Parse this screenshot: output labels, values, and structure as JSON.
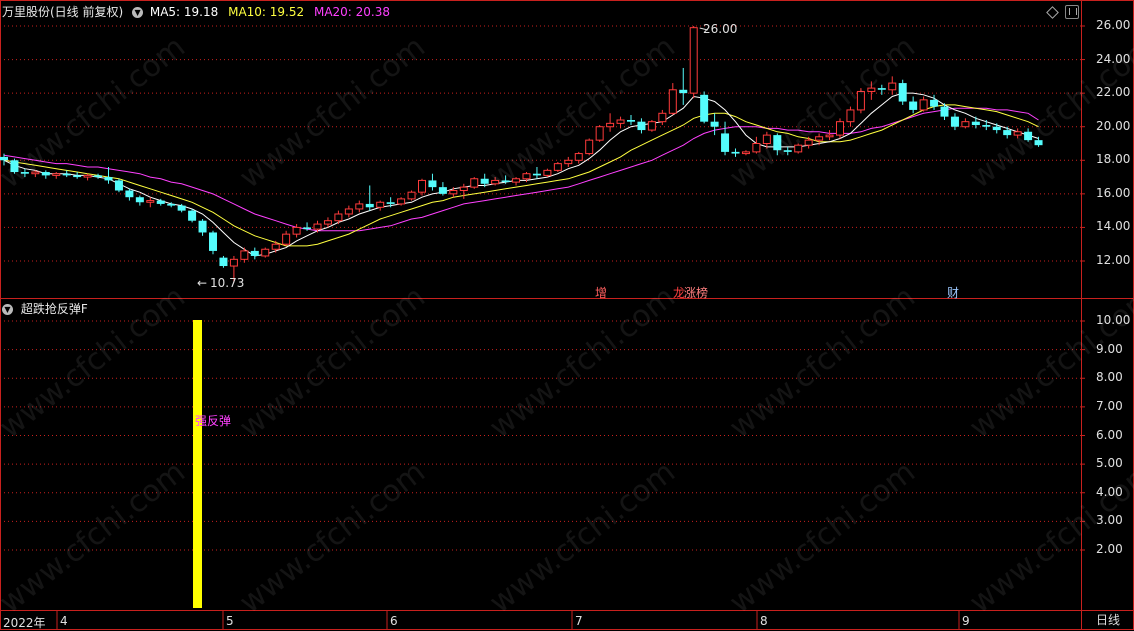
{
  "main_panel": {
    "title": "万里股份(日线 前复权)",
    "ma5": "MA5: 19.18",
    "ma10": "MA10: 19.52",
    "ma20": "MA20: 20.38",
    "colors": {
      "ma5": "#ffffff",
      "ma10": "#ffff40",
      "ma20": "#ff40ff",
      "up": "#ff3b3b",
      "down": "#54fcfc"
    },
    "y_ticks": [
      "26.00",
      "24.00",
      "22.00",
      "20.00",
      "18.00",
      "16.00",
      "14.00",
      "12.00"
    ],
    "high_label": "26.00",
    "low_label": "10.73",
    "events": {
      "increase": "增",
      "dragon_tiger": "龙",
      "limit_rank": "涨榜",
      "finance": "财"
    }
  },
  "sub_panel": {
    "title": "超跌抢反弹F",
    "signal_label": "强反弹",
    "signal_color": "#ffff00",
    "y_ticks": [
      "10.00",
      "9.00",
      "8.00",
      "7.00",
      "6.00",
      "5.00",
      "4.00",
      "3.00",
      "2.00"
    ]
  },
  "x_axis": {
    "year": "2022年",
    "months": [
      "4",
      "5",
      "6",
      "7",
      "8",
      "9"
    ]
  },
  "period_label": "日线",
  "watermark": "www.cfchi.com",
  "chart_data": {
    "type": "candlestick",
    "title": "万里股份(日线 前复权)",
    "ylim": [
      11.0,
      26.7
    ],
    "months": [
      "4",
      "5",
      "6",
      "7",
      "8",
      "9"
    ],
    "ohlc": [
      [
        18.2,
        18.4,
        17.7,
        18.0
      ],
      [
        18.0,
        18.1,
        17.2,
        17.3
      ],
      [
        17.3,
        17.5,
        17.0,
        17.2
      ],
      [
        17.2,
        17.4,
        17.0,
        17.3
      ],
      [
        17.3,
        17.4,
        16.9,
        17.1
      ],
      [
        17.1,
        17.3,
        16.9,
        17.2
      ],
      [
        17.2,
        17.4,
        17.0,
        17.1
      ],
      [
        17.1,
        17.3,
        16.9,
        17.0
      ],
      [
        17.0,
        17.2,
        16.8,
        17.1
      ],
      [
        17.1,
        17.2,
        16.9,
        17.0
      ],
      [
        17.0,
        17.6,
        16.6,
        16.8
      ],
      [
        16.8,
        16.9,
        16.1,
        16.2
      ],
      [
        16.2,
        16.3,
        15.6,
        15.8
      ],
      [
        15.8,
        15.9,
        15.3,
        15.5
      ],
      [
        15.5,
        15.8,
        15.2,
        15.6
      ],
      [
        15.6,
        15.7,
        15.3,
        15.4
      ],
      [
        15.4,
        15.5,
        15.2,
        15.3
      ],
      [
        15.3,
        15.4,
        14.9,
        15.0
      ],
      [
        15.0,
        15.1,
        14.3,
        14.4
      ],
      [
        14.4,
        14.5,
        13.5,
        13.7
      ],
      [
        13.7,
        13.8,
        12.4,
        12.6
      ],
      [
        12.2,
        12.3,
        11.6,
        11.7
      ],
      [
        11.7,
        12.3,
        10.73,
        12.1
      ],
      [
        12.1,
        12.8,
        11.9,
        12.6
      ],
      [
        12.6,
        12.8,
        12.1,
        12.3
      ],
      [
        12.3,
        12.8,
        12.2,
        12.7
      ],
      [
        12.7,
        13.2,
        12.5,
        13.0
      ],
      [
        13.0,
        13.8,
        12.9,
        13.6
      ],
      [
        13.6,
        14.2,
        13.4,
        14.0
      ],
      [
        14.0,
        14.3,
        13.8,
        13.9
      ],
      [
        13.9,
        14.4,
        13.7,
        14.2
      ],
      [
        14.2,
        14.6,
        14.0,
        14.4
      ],
      [
        14.4,
        15.0,
        14.2,
        14.8
      ],
      [
        14.8,
        15.3,
        14.6,
        15.1
      ],
      [
        15.1,
        15.6,
        14.9,
        15.4
      ],
      [
        15.4,
        16.5,
        15.0,
        15.2
      ],
      [
        15.2,
        15.6,
        15.0,
        15.5
      ],
      [
        15.5,
        15.8,
        15.2,
        15.4
      ],
      [
        15.4,
        15.8,
        15.3,
        15.7
      ],
      [
        15.7,
        16.2,
        15.6,
        16.1
      ],
      [
        16.1,
        16.9,
        15.9,
        16.8
      ],
      [
        16.8,
        17.2,
        16.2,
        16.4
      ],
      [
        16.4,
        16.7,
        15.9,
        16.0
      ],
      [
        16.0,
        16.4,
        15.8,
        16.2
      ],
      [
        16.2,
        16.6,
        15.7,
        16.4
      ],
      [
        16.4,
        17.0,
        16.3,
        16.9
      ],
      [
        16.9,
        17.2,
        16.4,
        16.6
      ],
      [
        16.6,
        17.0,
        16.5,
        16.8
      ],
      [
        16.8,
        17.1,
        16.6,
        16.7
      ],
      [
        16.7,
        17.0,
        16.5,
        16.9
      ],
      [
        16.9,
        17.3,
        16.7,
        17.2
      ],
      [
        17.2,
        17.6,
        16.9,
        17.1
      ],
      [
        17.1,
        17.5,
        17.0,
        17.4
      ],
      [
        17.4,
        17.9,
        17.3,
        17.8
      ],
      [
        17.8,
        18.2,
        17.6,
        18.0
      ],
      [
        18.0,
        18.5,
        17.8,
        18.4
      ],
      [
        18.4,
        19.3,
        18.3,
        19.2
      ],
      [
        19.2,
        20.1,
        19.1,
        20.0
      ],
      [
        20.0,
        20.8,
        19.7,
        20.2
      ],
      [
        20.2,
        20.6,
        19.9,
        20.4
      ],
      [
        20.4,
        20.7,
        20.1,
        20.3
      ],
      [
        20.3,
        20.5,
        19.6,
        19.8
      ],
      [
        19.8,
        20.4,
        19.7,
        20.3
      ],
      [
        20.3,
        21.0,
        20.1,
        20.8
      ],
      [
        20.8,
        22.6,
        20.7,
        22.2
      ],
      [
        22.2,
        23.5,
        21.3,
        22.0
      ],
      [
        22.0,
        26.0,
        21.7,
        25.9
      ],
      [
        21.9,
        22.1,
        20.2,
        20.3
      ],
      [
        20.3,
        20.8,
        19.5,
        20.0
      ],
      [
        19.6,
        20.3,
        18.3,
        18.5
      ],
      [
        18.5,
        18.7,
        18.2,
        18.4
      ],
      [
        18.4,
        18.6,
        18.3,
        18.5
      ],
      [
        18.5,
        19.4,
        18.4,
        19.0
      ],
      [
        19.0,
        19.7,
        18.7,
        19.5
      ],
      [
        19.5,
        19.6,
        18.3,
        18.6
      ],
      [
        18.6,
        18.8,
        18.3,
        18.5
      ],
      [
        18.5,
        19.0,
        18.4,
        18.9
      ],
      [
        18.9,
        19.4,
        18.7,
        19.2
      ],
      [
        19.2,
        19.6,
        18.9,
        19.4
      ],
      [
        19.4,
        19.8,
        19.2,
        19.5
      ],
      [
        19.5,
        20.5,
        19.3,
        20.3
      ],
      [
        20.3,
        21.2,
        20.0,
        21.0
      ],
      [
        21.0,
        22.3,
        20.8,
        22.1
      ],
      [
        22.1,
        22.7,
        21.6,
        22.3
      ],
      [
        22.3,
        22.5,
        21.9,
        22.2
      ],
      [
        22.2,
        23.0,
        21.9,
        22.6
      ],
      [
        22.6,
        22.8,
        21.3,
        21.5
      ],
      [
        21.5,
        21.8,
        20.8,
        21.0
      ],
      [
        21.0,
        21.8,
        20.9,
        21.6
      ],
      [
        21.6,
        21.9,
        21.0,
        21.2
      ],
      [
        21.2,
        21.4,
        20.4,
        20.6
      ],
      [
        20.6,
        20.8,
        19.8,
        20.0
      ],
      [
        20.0,
        20.5,
        19.9,
        20.3
      ],
      [
        20.3,
        20.6,
        19.9,
        20.1
      ],
      [
        20.1,
        20.4,
        19.8,
        20.0
      ],
      [
        20.0,
        20.2,
        19.6,
        19.8
      ],
      [
        19.8,
        20.0,
        19.3,
        19.5
      ],
      [
        19.5,
        19.9,
        19.3,
        19.7
      ],
      [
        19.7,
        19.9,
        19.1,
        19.2
      ],
      [
        19.2,
        19.4,
        18.8,
        18.9
      ]
    ],
    "ma5": [
      18.0,
      17.7,
      17.5,
      17.4,
      17.2,
      17.2,
      17.2,
      17.1,
      17.1,
      17.0,
      16.9,
      16.6,
      16.3,
      16.1,
      15.8,
      15.6,
      15.4,
      15.3,
      15.1,
      14.8,
      14.3,
      13.7,
      13.1,
      12.7,
      12.3,
      12.4,
      12.6,
      12.8,
      13.2,
      13.5,
      13.8,
      14.0,
      14.3,
      14.5,
      14.8,
      15.0,
      15.2,
      15.3,
      15.4,
      15.5,
      15.8,
      16.0,
      16.1,
      16.3,
      16.4,
      16.5,
      16.5,
      16.6,
      16.7,
      16.8,
      16.8,
      16.9,
      17.0,
      17.2,
      17.5,
      17.7,
      18.1,
      18.6,
      19.2,
      19.7,
      20.0,
      20.1,
      20.2,
      20.3,
      20.7,
      21.1,
      21.8,
      21.7,
      21.5,
      21.0,
      20.3,
      19.5,
      19.0,
      18.8,
      18.8,
      18.8,
      18.8,
      18.9,
      19.0,
      19.1,
      19.3,
      19.6,
      20.2,
      20.8,
      21.3,
      21.8,
      22.0,
      22.0,
      21.9,
      21.7,
      21.3,
      21.0,
      20.8,
      20.5,
      20.3,
      20.1,
      19.9,
      19.7,
      19.5,
      19.3
    ],
    "ma10": [
      18.0,
      17.9,
      17.8,
      17.7,
      17.6,
      17.5,
      17.4,
      17.3,
      17.2,
      17.1,
      17.0,
      16.9,
      16.7,
      16.5,
      16.3,
      16.1,
      15.9,
      15.7,
      15.5,
      15.2,
      14.9,
      14.5,
      14.1,
      13.8,
      13.5,
      13.3,
      13.1,
      12.9,
      12.9,
      12.9,
      13.0,
      13.2,
      13.4,
      13.6,
      13.9,
      14.2,
      14.5,
      14.7,
      14.9,
      15.1,
      15.3,
      15.5,
      15.6,
      15.8,
      15.9,
      16.0,
      16.1,
      16.2,
      16.3,
      16.4,
      16.5,
      16.6,
      16.7,
      16.8,
      16.9,
      17.1,
      17.3,
      17.6,
      17.9,
      18.2,
      18.6,
      18.9,
      19.2,
      19.5,
      19.8,
      20.1,
      20.5,
      20.7,
      20.8,
      20.8,
      20.6,
      20.3,
      20.1,
      19.9,
      19.7,
      19.6,
      19.4,
      19.3,
      19.1,
      19.1,
      19.1,
      19.2,
      19.4,
      19.6,
      19.8,
      20.1,
      20.4,
      20.7,
      21.0,
      21.2,
      21.3,
      21.3,
      21.2,
      21.1,
      21.0,
      20.9,
      20.7,
      20.5,
      20.3,
      20.0
    ],
    "ma20": [
      18.3,
      18.2,
      18.1,
      18.0,
      17.9,
      17.8,
      17.8,
      17.7,
      17.6,
      17.6,
      17.5,
      17.4,
      17.3,
      17.2,
      17.0,
      16.9,
      16.7,
      16.6,
      16.4,
      16.2,
      16.0,
      15.7,
      15.4,
      15.1,
      14.8,
      14.6,
      14.4,
      14.2,
      14.0,
      13.9,
      13.8,
      13.8,
      13.8,
      13.8,
      13.8,
      13.9,
      14.0,
      14.1,
      14.3,
      14.5,
      14.6,
      14.8,
      15.0,
      15.2,
      15.4,
      15.5,
      15.6,
      15.7,
      15.8,
      15.9,
      16.0,
      16.1,
      16.2,
      16.3,
      16.4,
      16.6,
      16.8,
      17.0,
      17.2,
      17.4,
      17.6,
      17.8,
      18.0,
      18.3,
      18.6,
      18.9,
      19.3,
      19.6,
      19.8,
      19.9,
      20.0,
      20.0,
      20.0,
      19.9,
      19.9,
      19.8,
      19.8,
      19.7,
      19.7,
      19.6,
      19.6,
      19.6,
      19.7,
      19.9,
      20.0,
      20.2,
      20.4,
      20.6,
      20.8,
      20.9,
      21.0,
      21.1,
      21.1,
      21.1,
      21.1,
      21.0,
      21.0,
      20.9,
      20.8,
      20.4
    ]
  }
}
